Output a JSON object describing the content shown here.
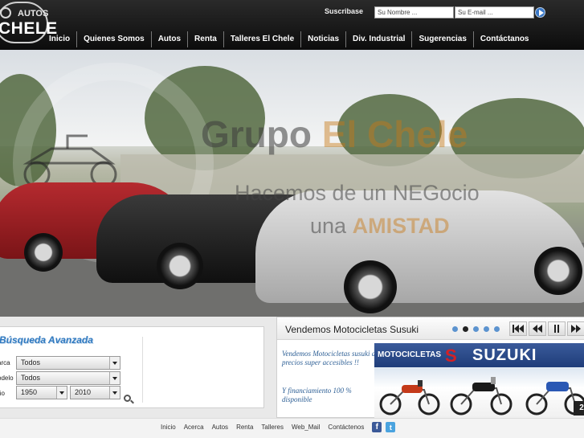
{
  "brand": {
    "logo_top": "AUTOS",
    "logo_main": "CHELE"
  },
  "subscribe": {
    "label": "Suscribase",
    "name_placeholder": "Su Nombre ...",
    "email_placeholder": "Su E-mail ..."
  },
  "nav": {
    "items": [
      "Inicio",
      "Quienes Somos",
      "Autos",
      "Renta",
      "Talleres El Chele",
      "Noticias",
      "Div. Industrial",
      "Sugerencias",
      "Contáctanos"
    ]
  },
  "hero": {
    "brand_word1": "Grupo",
    "brand_word2": "El Chele",
    "tagline_line1": "Hacemos de un NEGocio",
    "tagline_line2_a": "una",
    "tagline_line2_b": "AMISTAD"
  },
  "search": {
    "title": "Búsqueda Avanzada",
    "marca_label": "arca",
    "modelo_label": "odelo",
    "anio_label": "ño",
    "marca_value": "Todos",
    "modelo_value": "Todos",
    "year_from": "1950",
    "year_to": "2010"
  },
  "promo": {
    "title": "Vendemos Motocicletas Susuki",
    "text_1": "Vendemos Motocicletas susuki a precios super accesibles !!",
    "text_2": "Y financiamiento 100 % disponible",
    "banner_label": "MOTOCICLETAS",
    "banner_s": "S",
    "banner_brand": "SUZUKI",
    "banner_number": "2"
  },
  "footer": {
    "links": [
      "Inicio",
      "Acerca",
      "Autos",
      "Renta",
      "Talleres",
      "Web_Mail",
      "Contáctenos"
    ],
    "fb": "f",
    "tw": "t"
  },
  "colors": {
    "header_bg": "#151515",
    "accent_blue": "#2f79c0",
    "promo_text": "#2d5f95",
    "suzuki_red": "#d42025"
  }
}
